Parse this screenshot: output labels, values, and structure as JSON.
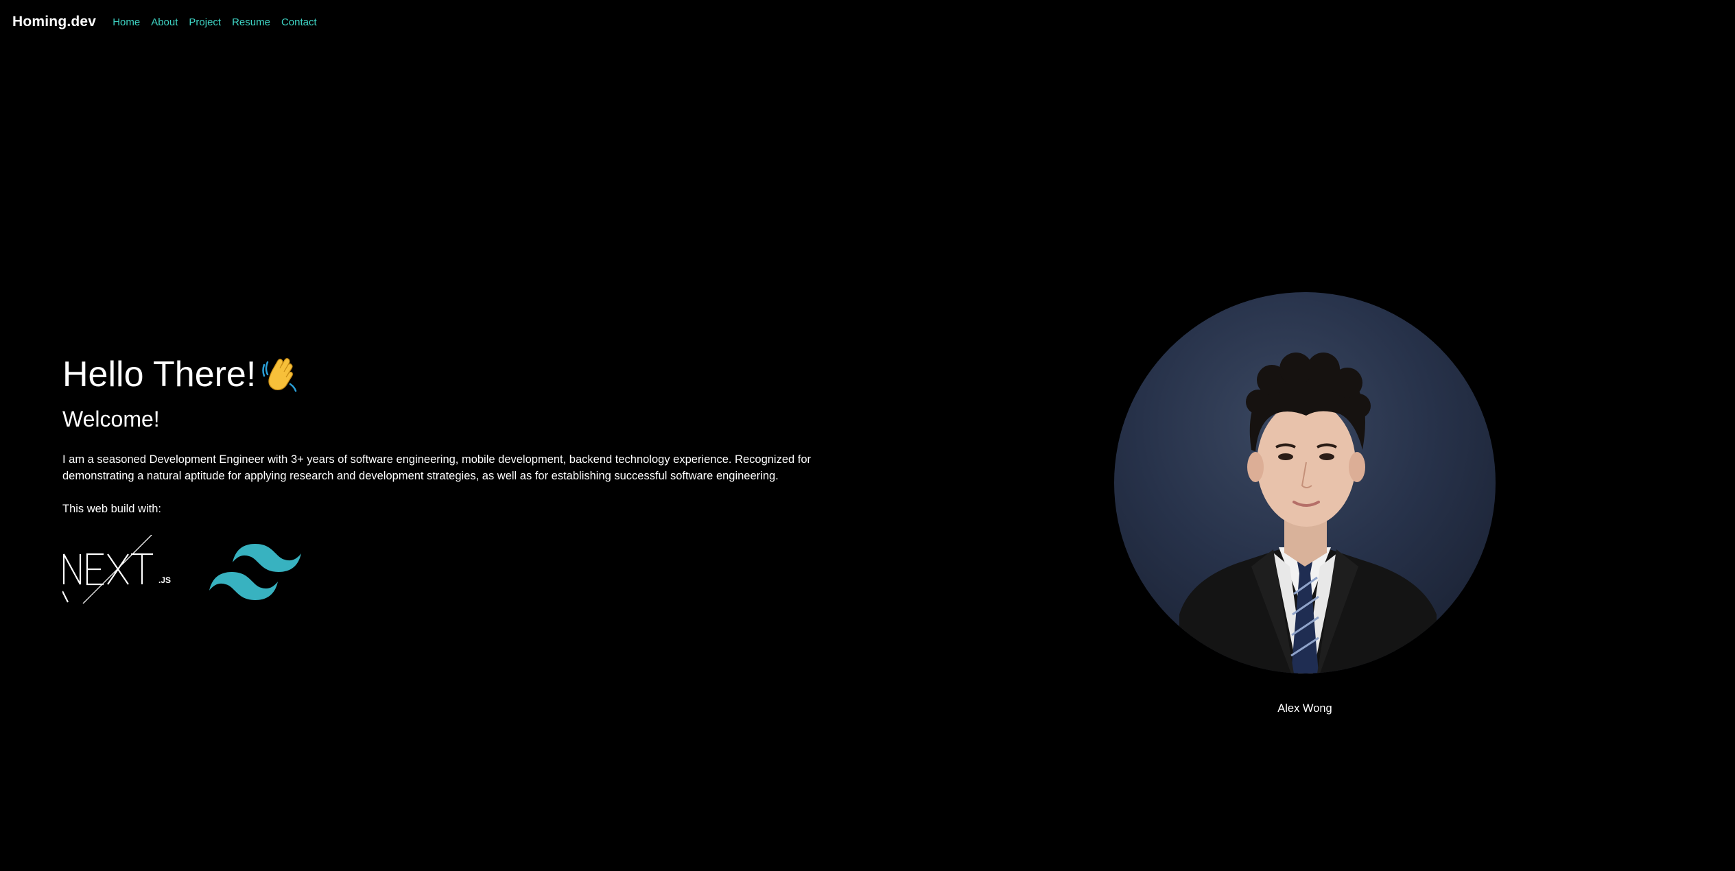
{
  "nav": {
    "brand": "Homing.dev",
    "links": [
      "Home",
      "About",
      "Project",
      "Resume",
      "Contact"
    ]
  },
  "hero": {
    "title": "Hello There!",
    "wave_icon": "waving-hand-icon",
    "subtitle": "Welcome!",
    "description": "I am a seasoned Development Engineer with 3+ years of software engineering, mobile development, backend technology experience. Recognized for demonstrating a natural aptitude for applying research and development strategies, as well as for establishing successful software engineering.",
    "built_with_label": "This web build with:",
    "logos": [
      "nextjs-logo",
      "tailwind-logo"
    ]
  },
  "profile": {
    "photo": "profile-photo",
    "name": "Alex Wong"
  },
  "colors": {
    "background": "#000000",
    "text": "#ffffff",
    "nav_link": "#3fd6c6",
    "tailwind": "#38b2c0"
  }
}
